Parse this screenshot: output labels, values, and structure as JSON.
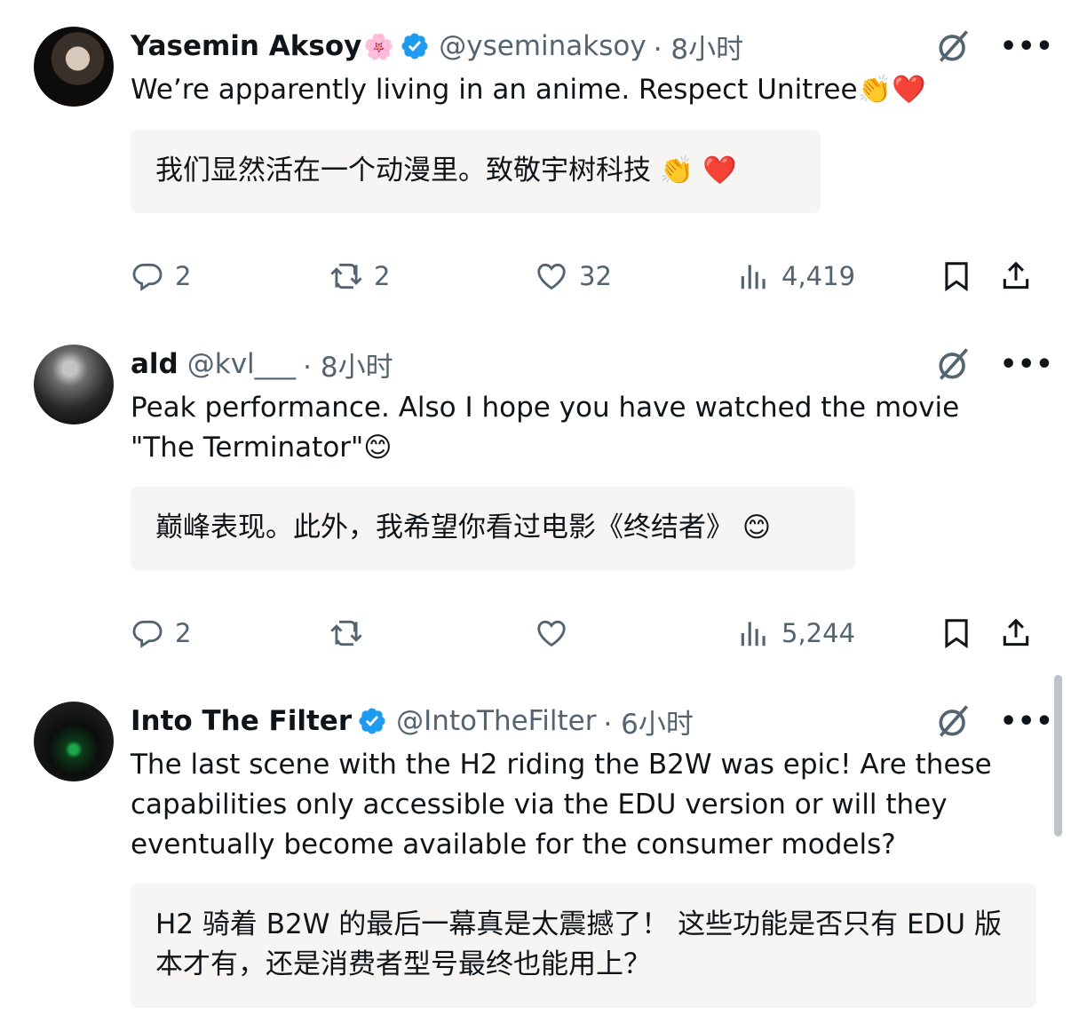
{
  "tweets": [
    {
      "name": "Yasemin Aksoy",
      "name_deco": "🌸",
      "verified": true,
      "handle": "@yseminaksoy",
      "time": "· 8小时",
      "text": "We’re apparently living in an anime. Respect Unitree👏❤️",
      "translation": "我们显然活在一个动漫里。致敬宇树科技 👏 ❤️",
      "replies": "2",
      "reposts": "2",
      "likes": "32",
      "views": "4,419"
    },
    {
      "name": "ald",
      "verified": false,
      "handle": "@kvl___",
      "time": "· 8小时",
      "text": "Peak performance. Also I hope you have watched the movie \"The Terminator\"😊",
      "translation": "巅峰表现。此外，我希望你看过电影《终结者》 😊",
      "replies": "2",
      "reposts": "",
      "likes": "",
      "views": "5,244"
    },
    {
      "name": "Into The Filter",
      "verified": true,
      "handle": "@IntoTheFilter",
      "time": "· 6小时",
      "text": "The last scene with the H2 riding the B2W was epic!  Are these capabilities only accessible via the EDU version or will they eventually become available for the consumer models?",
      "translation": "H2 骑着 B2W 的最后一幕真是太震撼了！ 这些功能是否只有 EDU 版本才有，还是消费者型号最终也能用上？"
    }
  ],
  "icons": {
    "more": "•••",
    "grok": "grok-icon",
    "reply": "reply-icon",
    "repost": "repost-icon",
    "like": "heart-icon",
    "views": "views-icon",
    "bookmark": "bookmark-icon",
    "share": "share-icon",
    "verified": "verified-badge-icon"
  },
  "colors": {
    "text": "#0f1419",
    "muted": "#536471",
    "verified": "#1d9bf0",
    "translation_bg": "#f7f5f4"
  }
}
